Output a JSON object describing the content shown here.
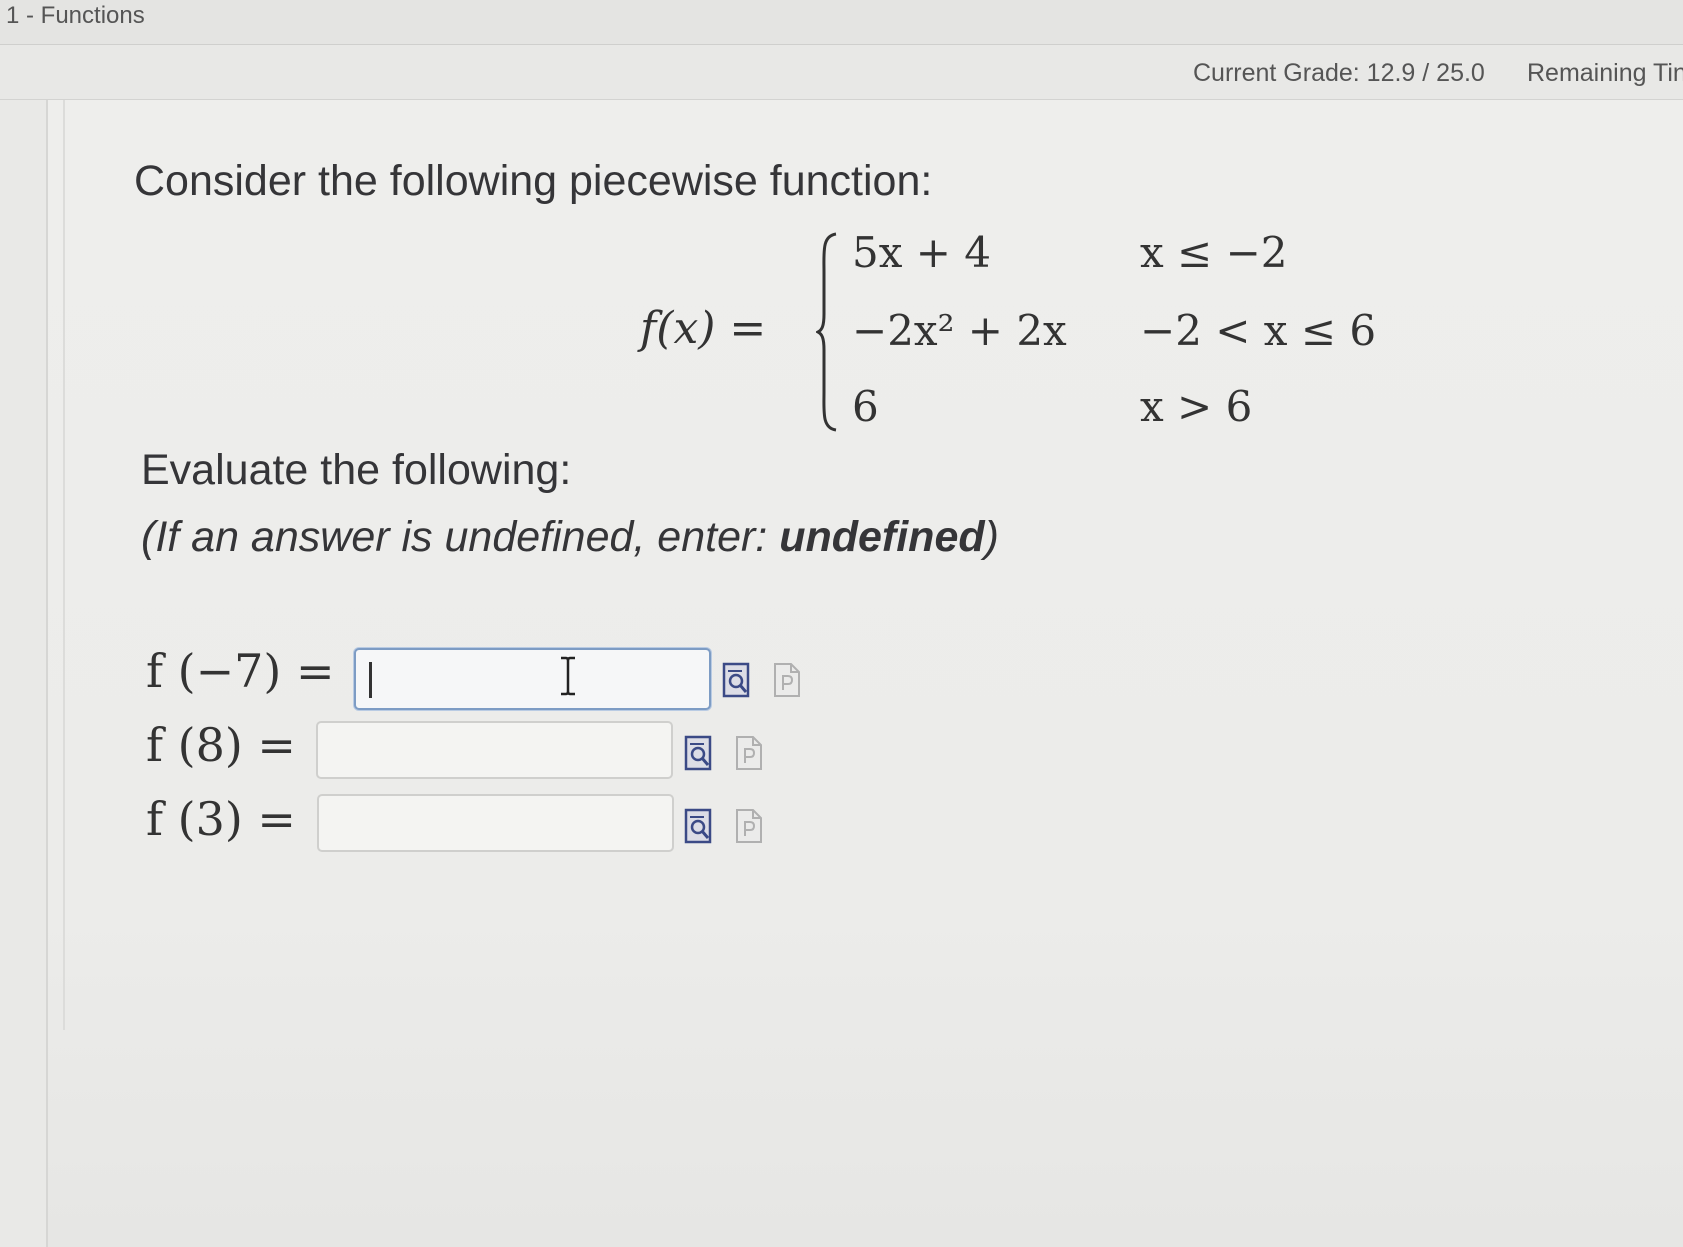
{
  "header": {
    "title": "1 - Functions"
  },
  "status": {
    "current_grade": "Current Grade: 12.9 / 25.0",
    "remaining_time": "Remaining Tin"
  },
  "question": {
    "intro": "Consider the following piecewise function:",
    "function_name": "f(x) =",
    "pieces": [
      {
        "expression": "5x + 4",
        "condition": "x ≤ −2"
      },
      {
        "expression": "−2x² + 2x",
        "condition": "−2 < x ≤ 6"
      },
      {
        "expression": "6",
        "condition": "x > 6"
      }
    ],
    "evaluate_heading": "Evaluate the following:",
    "instruction_prefix": "(If an answer is undefined, enter: ",
    "instruction_keyword": "undefined",
    "instruction_suffix": ")"
  },
  "answers": [
    {
      "label": "f (−7) =",
      "value": ""
    },
    {
      "label": "f (8) =",
      "value": ""
    },
    {
      "label": "f (3) =",
      "value": ""
    }
  ],
  "icons": {
    "preview": "preview-icon",
    "help": "help-icon"
  }
}
